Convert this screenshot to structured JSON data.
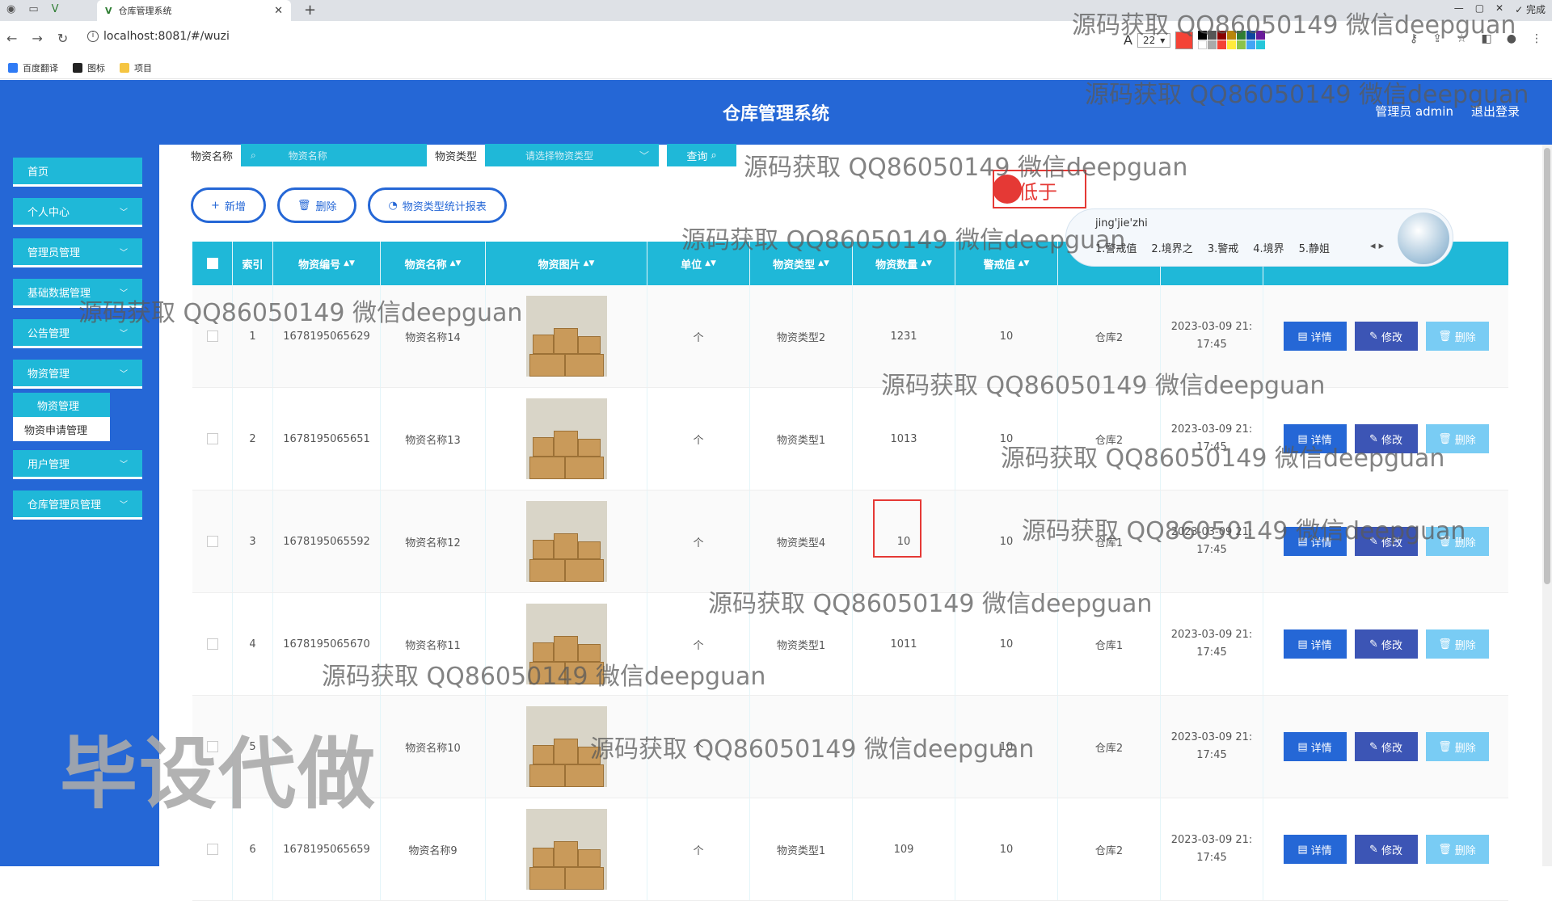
{
  "browser": {
    "tab_title": "仓库管理系统",
    "url": "localhost:8081/#/wuzi",
    "zoom": "22",
    "done_label": "完成",
    "bookmarks": [
      "百度翻译",
      "图标",
      "项目"
    ]
  },
  "header": {
    "title": "仓库管理系统",
    "user_label": "管理员 admin",
    "logout_label": "退出登录"
  },
  "sidebar": {
    "items": [
      {
        "label": "首页"
      },
      {
        "label": "个人中心"
      },
      {
        "label": "管理员管理"
      },
      {
        "label": "基础数据管理"
      },
      {
        "label": "公告管理"
      },
      {
        "label": "物资管理"
      },
      {
        "label": "用户管理"
      },
      {
        "label": "仓库管理员管理"
      }
    ],
    "submenu": [
      "物资管理",
      "物资申请管理"
    ]
  },
  "search": {
    "name_label": "物资名称",
    "name_placeholder": "物资名称",
    "type_label": "物资类型",
    "type_placeholder": "请选择物资类型",
    "query_label": "查询"
  },
  "actions": {
    "add": "新增",
    "delete": "删除",
    "report": "物资类型统计报表"
  },
  "table": {
    "columns": [
      "索引",
      "物资编号",
      "物资名称",
      "物资图片",
      "单位",
      "物资类型",
      "物资数量",
      "警戒值"
    ],
    "buttons": {
      "detail": "详情",
      "edit": "修改",
      "delete": "删除"
    },
    "rows": [
      {
        "idx": "1",
        "code": "1678195065629",
        "name": "物资名称14",
        "unit": "个",
        "type": "物资类型2",
        "qty": "1231",
        "warn": "10",
        "warehouse": "仓库2",
        "date1": "2023-03-09 21:",
        "date2": "17:45"
      },
      {
        "idx": "2",
        "code": "1678195065651",
        "name": "物资名称13",
        "unit": "个",
        "type": "物资类型1",
        "qty": "1013",
        "warn": "10",
        "warehouse": "仓库2",
        "date1": "2023-03-09 21:",
        "date2": "17:45"
      },
      {
        "idx": "3",
        "code": "1678195065592",
        "name": "物资名称12",
        "unit": "个",
        "type": "物资类型4",
        "qty": "10",
        "warn": "10",
        "warehouse": "仓库1",
        "date1": "2023-03-09 21:",
        "date2": "17:45"
      },
      {
        "idx": "4",
        "code": "1678195065670",
        "name": "物资名称11",
        "unit": "个",
        "type": "物资类型1",
        "qty": "1011",
        "warn": "10",
        "warehouse": "仓库1",
        "date1": "2023-03-09 21:",
        "date2": "17:45"
      },
      {
        "idx": "5",
        "code": "",
        "name": "物资名称10",
        "unit": "个",
        "type": "",
        "qty": "",
        "warn": "10",
        "warehouse": "仓库2",
        "date1": "2023-03-09 21:",
        "date2": "17:45"
      },
      {
        "idx": "6",
        "code": "1678195065659",
        "name": "物资名称9",
        "unit": "个",
        "type": "物资类型1",
        "qty": "109",
        "warn": "10",
        "warehouse": "仓库2",
        "date1": "2023-03-09 21:",
        "date2": "17:45"
      }
    ]
  },
  "ime": {
    "composition": "jing'jie'zhi",
    "candidates": [
      "1.警戒值",
      "2.境界之",
      "3.警戒",
      "4.境界",
      "5.静姐"
    ],
    "annotation": "低于"
  },
  "overlays": {
    "watermark": "源码获取 QQ86050149 微信deepguan",
    "big_mark": "毕设代做"
  }
}
